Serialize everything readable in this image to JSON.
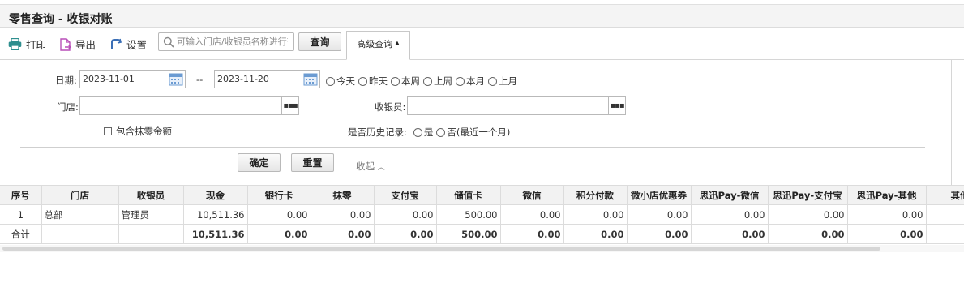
{
  "page": {
    "title": "零售查询 - 收银对账"
  },
  "toolbar": {
    "print": "打印",
    "export": "导出",
    "settings": "设置",
    "search_placeholder": "可输入门店/收银员名称进行查",
    "query": "查询",
    "advanced_query": "高级查询"
  },
  "filters": {
    "date_label": "日期:",
    "date_from": "2023-11-01",
    "date_sep": "--",
    "date_to": "2023-11-20",
    "quick_dates": [
      "今天",
      "昨天",
      "本周",
      "上周",
      "本月",
      "上月"
    ],
    "store_label": "门店:",
    "store_value": "",
    "cashier_label": "收银员:",
    "cashier_value": "",
    "include_rounding": "包含抹零金额",
    "history_label": "是否历史记录:",
    "history_yes": "是",
    "history_no": "否(最近一个月)",
    "confirm": "确定",
    "reset": "重置",
    "collapse": "收起"
  },
  "table": {
    "columns": [
      "序号",
      "门店",
      "收银员",
      "现金",
      "银行卡",
      "抹零",
      "支付宝",
      "储值卡",
      "微信",
      "积分付款",
      "微小店优惠券",
      "思迅Pay-微信",
      "思迅Pay-支付宝",
      "思迅Pay-其他",
      "其他"
    ],
    "rows": [
      [
        "1",
        "总部",
        "管理员",
        "10,511.36",
        "0.00",
        "0.00",
        "0.00",
        "500.00",
        "0.00",
        "0.00",
        "0.00",
        "0.00",
        "0.00",
        "0.00",
        ""
      ]
    ],
    "total": [
      "合计",
      "",
      "",
      "10,511.36",
      "0.00",
      "0.00",
      "0.00",
      "500.00",
      "0.00",
      "0.00",
      "0.00",
      "0.00",
      "0.00",
      "0.00",
      ""
    ]
  },
  "colors": {
    "accent_blue": "#3b6fb6",
    "export_purple": "#b84fb8",
    "print_teal": "#2f8f8f",
    "calendar_blue": "#6b9bd2"
  }
}
